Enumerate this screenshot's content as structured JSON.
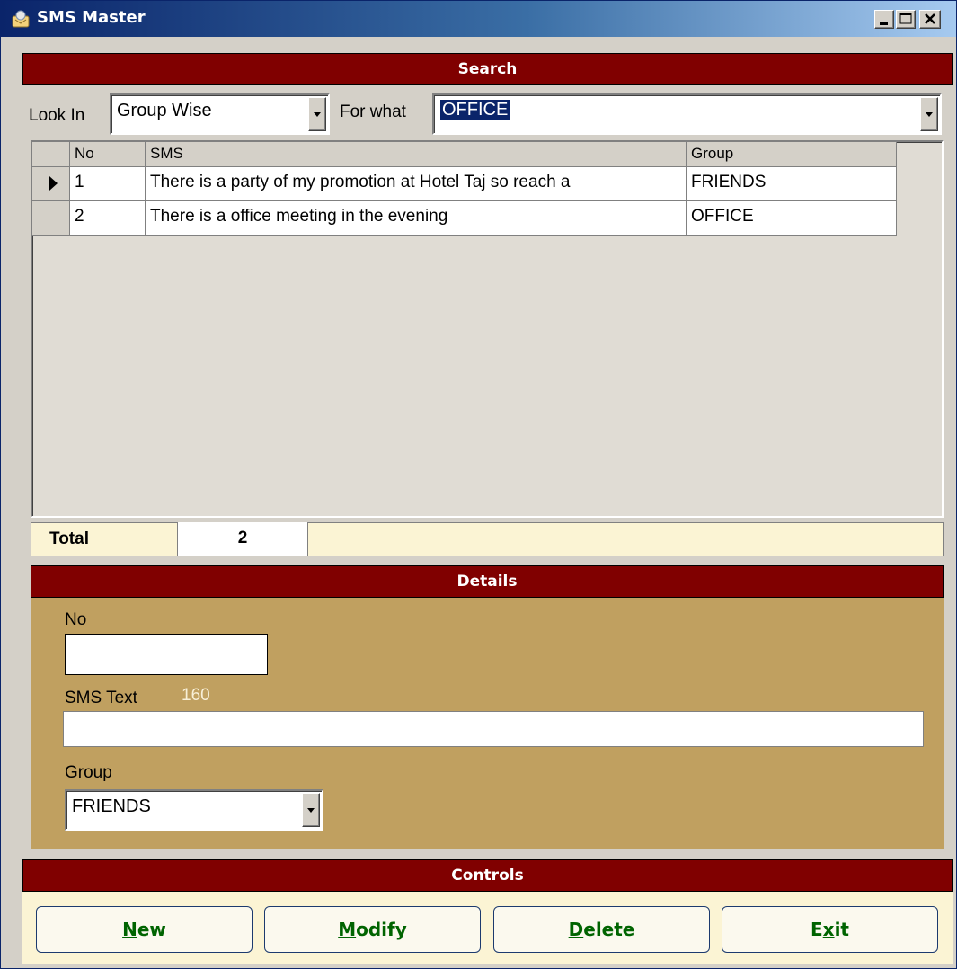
{
  "window": {
    "title": "SMS Master"
  },
  "search": {
    "header": "Search",
    "look_in_label": "Look In",
    "look_in_value": "Group Wise",
    "for_what_label": "For what",
    "for_what_value": "OFFICE",
    "columns": [
      "No",
      "SMS",
      "Group"
    ],
    "rows": [
      {
        "no": "1",
        "sms": "There is a party of my promotion at Hotel Taj so reach a",
        "group": "FRIENDS",
        "selected": true
      },
      {
        "no": "2",
        "sms": "There is a office meeting in the evening",
        "group": "OFFICE",
        "selected": false
      }
    ],
    "total_label": "Total",
    "total_value": "2"
  },
  "details": {
    "header": "Details",
    "no_label": "No",
    "no_value": "",
    "sms_text_label": "SMS Text",
    "sms_text_counter": "160",
    "sms_text_value": "",
    "group_label": "Group",
    "group_value": "FRIENDS"
  },
  "controls": {
    "header": "Controls",
    "new": {
      "hotkey": "N",
      "rest": "ew"
    },
    "modify": {
      "hotkey": "M",
      "rest": "odify"
    },
    "delete": {
      "hotkey": "D",
      "rest": "elete"
    },
    "exit": {
      "pre": "E",
      "hotkey": "x",
      "rest": "it"
    }
  },
  "colors": {
    "header_bg": "#800000",
    "details_bg": "#C0A060",
    "button_text": "#006400",
    "selection_bg": "#0A246A"
  },
  "icons": [
    "app-icon",
    "minimize-icon",
    "maximize-icon",
    "close-icon",
    "dropdown-arrow-icon",
    "row-pointer-icon"
  ]
}
